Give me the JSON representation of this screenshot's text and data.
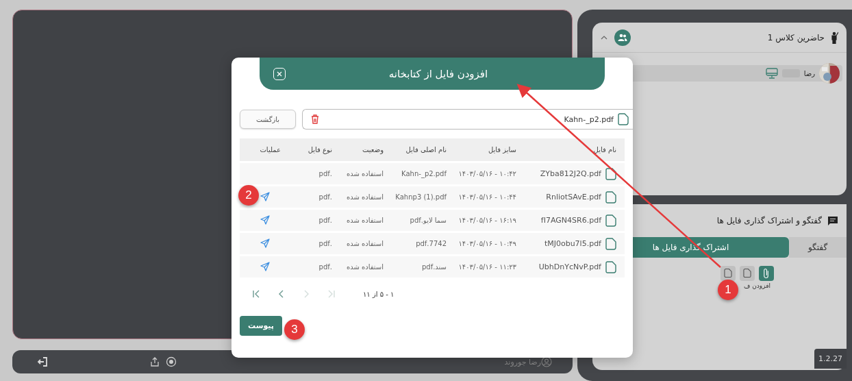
{
  "stage": {
    "user_name": "رضا جوروند"
  },
  "participants_panel": {
    "title": "حاضرین کلاس 1",
    "expanded": true,
    "participants": [
      {
        "name": "رضا"
      }
    ]
  },
  "chat_panel": {
    "title": "گفتگو و اشتراک گذاری فایل ها",
    "tabs": [
      {
        "label": "گفتگو",
        "selected": false
      },
      {
        "label": "اشتراک گذاری فایل ها",
        "selected": true
      }
    ],
    "tools": [
      {
        "kind": "attach",
        "selected": true
      },
      {
        "kind": "file",
        "selected": false
      },
      {
        "kind": "file",
        "selected": false
      }
    ],
    "tool_label": "افزودن ف"
  },
  "version": "1.2.27",
  "dialog": {
    "title": "افزودن فایل از کتابخانه",
    "back_button": "بازگشت",
    "selected_file": "Kahn-_p2.pdf",
    "columns": [
      "نام فایل",
      "سایز فایل",
      "نام اصلی فایل",
      "وضعیت",
      "نوع فایل",
      "عملیات"
    ],
    "rows": [
      {
        "file_name": "ZYba812J2Q.pdf",
        "size": "۱۰:۴۲ - ۱۴۰۳/۰۵/۱۶",
        "original_name": "Kahn-_p2.pdf",
        "status": "استفاده شده",
        "type": ".pdf",
        "sendable": false
      },
      {
        "file_name": "RnliotSAvE.pdf",
        "size": "۱۰:۴۴ - ۱۴۰۳/۰۵/۱۶",
        "original_name": "Kahnp3 (1).pdf",
        "status": "استفاده شده",
        "type": ".pdf",
        "sendable": true
      },
      {
        "file_name": "fI7AGN4SR6.pdf",
        "size": "۱۶:۱۹ - ۱۴۰۳/۰۵/۱۶",
        "original_name": "سما لایو.pdf",
        "status": "استفاده شده",
        "type": ".pdf",
        "sendable": true
      },
      {
        "file_name": "tMJ0obu7l5.pdf",
        "size": "۱۰:۴۹ - ۱۴۰۳/۰۵/۱۶",
        "original_name": "7742.pdf",
        "status": "استفاده شده",
        "type": ".pdf",
        "sendable": true
      },
      {
        "file_name": "UbhDnYcNvP.pdf",
        "size": "۱۱:۲۳ - ۱۴۰۳/۰۵/۱۶",
        "original_name": "سند.pdf",
        "status": "استفاده شده",
        "type": ".pdf",
        "sendable": true
      }
    ],
    "pagination": {
      "range": "۱ - ۵ از ۱۱",
      "buttons": [
        {
          "kind": "first",
          "disabled": false
        },
        {
          "kind": "prev",
          "disabled": false
        },
        {
          "kind": "next",
          "disabled": true
        },
        {
          "kind": "last",
          "disabled": true
        }
      ]
    },
    "attach_button": "پیوست"
  },
  "annotations": [
    {
      "number": "1"
    },
    {
      "number": "2"
    },
    {
      "number": "3"
    }
  ]
}
